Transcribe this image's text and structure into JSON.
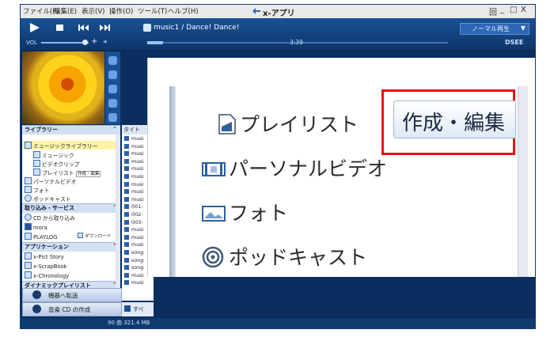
{
  "menu": [
    "ファイル(F)",
    "編集(E)",
    "表示(V)",
    "操作(O)",
    "ツール(T)",
    "ヘルプ(H)"
  ],
  "app_title": "x-アプリ",
  "window_controls": [
    "回",
    "_",
    "□",
    "X"
  ],
  "transport": {
    "now_playing": "music1 / Dance! Dance!",
    "vol_label": "VOL",
    "time": "3:39",
    "mode": "ノーマル再生",
    "mode_arrow": "▼",
    "dsee": "DSEE"
  },
  "sidebar": {
    "library_header": "ライブラリー",
    "music_library": "ミュージックライブラリー",
    "music": "ミュージック",
    "video_clip": "ビデオクリップ",
    "playlist": "プレイリスト",
    "edit_badge": "作成・編集",
    "personal_video": "パーソナルビデオ",
    "photo": "フォト",
    "podcast": "ポッドキャスト",
    "import_header": "取り込み・サービス",
    "cd_import": "CD から取り込み",
    "mora": "mora",
    "playlog": "PLAYLOG",
    "download": "ダウンロード",
    "apps_header": "アプリケーション",
    "app1": "x-Pict Story",
    "app2": "x-ScrapBook",
    "app3": "x-Chronology",
    "dynamic_header": "ダイナミックプレイリスト",
    "collapse": "⌃"
  },
  "buttons": {
    "transfer": "機器へ転送",
    "burn": "音楽 CD の作成"
  },
  "list": {
    "header": "タイト",
    "rows": [
      "musi",
      "musi",
      "musi",
      "musi",
      "musi",
      "musi",
      "musi",
      "musi",
      "musi",
      "001-",
      "002-",
      "003-",
      "musi",
      "musi",
      "musi",
      "song",
      "song",
      "song",
      "musi",
      "musi"
    ],
    "select_all": "すべ"
  },
  "status": "90 曲 321.4 MB",
  "zoom": {
    "playlist": "プレイリスト",
    "edit_button": "作成・編集",
    "personal_video": "パーソナルビデオ",
    "photo": "フォト",
    "podcast": "ポッドキャスト"
  },
  "colors": {
    "app_bg": "#0b2e5e",
    "highlight": "#e81018",
    "selected_item": "#fff3a6"
  }
}
